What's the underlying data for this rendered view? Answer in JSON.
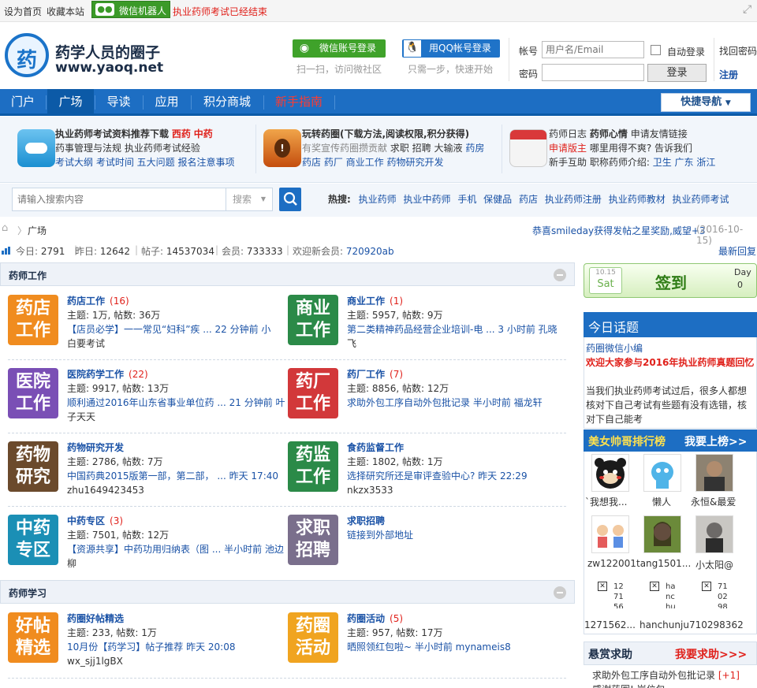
{
  "topbar": {
    "set_home": "设为首页",
    "bookmark": "收藏本站",
    "wechat_bot": "微信机器人",
    "notice": "执业药师考试已经结束"
  },
  "header": {
    "logo_char": "药",
    "site_title": "药学人员的圈子",
    "site_url": "www.yaoq.net",
    "wechat_login": "微信账号登录",
    "wechat_sub": "扫一扫，访问微社区",
    "qq_login": "用QQ帐号登录",
    "qq_sub": "只需一步，快速开始",
    "account_label": "帐号",
    "account_placeholder": "用户名/Email",
    "auto_login": "自动登录",
    "find_pwd": "找回密码",
    "password_label": "密码",
    "login_button": "登录",
    "register": "注册"
  },
  "nav": {
    "items": [
      "门户",
      "广场",
      "导读",
      "应用",
      "积分商城",
      "新手指南"
    ],
    "quick": "快捷导航"
  },
  "promo": {
    "col1": {
      "title": "执业药师考试资料推荐下载",
      "t1": "西药",
      "t2": "中药",
      "l2": "药事管理与法规  执业药师考试经验",
      "l3": "考试大纲  考试时间  五大问题  报名注意事项"
    },
    "col2": {
      "title": "玩转药圈(下载方法,阅读权限,积分获得)",
      "l2a": "有奖宣传药圈攒贡献",
      "l2b": "求职  招聘  大输液",
      "l2c": "药房",
      "l3": "药店  药厂  商业工作  药物研究开发"
    },
    "col3": {
      "l1a": "药师日志",
      "l1b": "药师心情",
      "l1c": "申请友情链接",
      "l2a": "申请版主",
      "l2b": "哪里用得不爽? 告诉我们",
      "l3a": "新手互助  职称药师介绍:",
      "l3b": "卫生  广东  浙江"
    }
  },
  "search": {
    "placeholder": "请输入搜索内容",
    "select": "搜索",
    "hot_label": "热搜:",
    "hot": [
      "执业药师",
      "执业中药师",
      "手机",
      "保健品",
      "药店",
      "执业药师注册",
      "执业药师教材",
      "执业药师考试"
    ]
  },
  "breadcrumb": {
    "current": "广场",
    "congrats": "恭喜smileday获得发帖之星奖励,威望+3",
    "congrats_date": "(2016-10-15)"
  },
  "stats": {
    "today_label": "今日:",
    "today": "2791",
    "yesterday_label": "昨日:",
    "yesterday": "12642",
    "posts_label": "帖子:",
    "posts": "14537034",
    "members_label": "会员:",
    "members": "733333",
    "welcome_label": "欢迎新会员:",
    "newest": "720920ab",
    "latest_reply": "最新回复"
  },
  "sections": [
    {
      "title": "药师工作"
    },
    {
      "title": "药师学习"
    }
  ],
  "forums": [
    {
      "tile1": "药店",
      "tile2": "工作",
      "name": "药店工作",
      "count": "(16)",
      "meta": "主题: 1万, 帖数: 36万",
      "last": "【店员必学】一一常见“妇科”疾 ... 22 分钟前  小",
      "last2": "白要考试"
    },
    {
      "tile1": "商业",
      "tile2": "工作",
      "name": "商业工作",
      "count": "(1)",
      "meta": "主题: 5957, 帖数: 9万",
      "last": "第二类精神药品经营企业培训-电 ... 3 小时前  孔晓",
      "last2": "飞"
    },
    {
      "tile1": "医院",
      "tile2": "工作",
      "name": "医院药学工作",
      "count": "(22)",
      "meta": "主题: 9917, 帖数: 13万",
      "last": "顺利通过2016年山东省事业单位药 ... 21 分钟前  叶",
      "last2": "子天天"
    },
    {
      "tile1": "药厂",
      "tile2": "工作",
      "name": "药厂工作",
      "count": "(7)",
      "meta": "主题: 8856, 帖数: 12万",
      "last": "求助外包工序自动外包批记录  半小时前  福龙轩",
      "last2": ""
    },
    {
      "tile1": "药物",
      "tile2": "研究",
      "name": "药物研究开发",
      "count": "",
      "meta": "主题: 2786, 帖数: 7万",
      "last": "中国药典2015版第一部，第二部，  ... 昨天 17:40",
      "last2": "zhu1649423453"
    },
    {
      "tile1": "药监",
      "tile2": "工作",
      "name": "食药监督工作",
      "count": "",
      "meta": "主题: 1802, 帖数: 1万",
      "last": "选择研究所还是审评查验中心?  昨天 22:29",
      "last2": "nkzx3533"
    },
    {
      "tile1": "中药",
      "tile2": "专区",
      "name": "中药专区",
      "count": "(3)",
      "meta": "主题: 7501, 帖数: 12万",
      "last": "【资源共享】中药功用归纳表（图 ... 半小时前  池边",
      "last2": "柳"
    },
    {
      "tile1": "求职",
      "tile2": "招聘",
      "name": "求职招聘",
      "count": "",
      "meta": "链接到外部地址",
      "last": "",
      "last2": ""
    },
    {
      "tile1": "好帖",
      "tile2": "精选",
      "name": "药圈好帖精选",
      "count": "",
      "meta": "主题: 233, 帖数: 1万",
      "last": "10月份【药学习】帖子推荐  昨天 20:08",
      "last2": "wx_sjj1lgBX"
    },
    {
      "tile1": "药圈",
      "tile2": "活动",
      "name": "药圈活动",
      "count": "(5)",
      "meta": "主题: 957, 帖数: 17万",
      "last": "晒照领红包啦~  半小时前  mynameis8",
      "last2": ""
    }
  ],
  "sidebar": {
    "checkin_date": "10.15",
    "checkin_day": "Sat",
    "checkin_label": "签到",
    "checkin_day_label": "Day",
    "checkin_count": "0",
    "topic_title": "今日话题",
    "topic_author": "药圈微信小编",
    "topic_headline": "欢迎大家参与2016年执业药师真题回忆",
    "topic_body": "当我们执业药师考试过后，很多人都想核对下自己考试有些题有没有选错，核对下自己能考",
    "rank_title": "美女帅哥排行榜",
    "rank_action": "我要上榜>>",
    "rank_names": [
      "`我想我...",
      "懒人",
      "永恒&最爱",
      "zw122001",
      "tang1501...",
      "小太阳@"
    ],
    "broken": [
      "12 71 56",
      "ha nc hu",
      "71 02 98"
    ],
    "broken_names": [
      "1271562...",
      "hanchunju",
      "710298362"
    ],
    "reward_title": "悬赏求助",
    "reward_action": "我要求助>>>",
    "reward_item": "求助外包工序自动外包批记录",
    "reward_pts": "[+1]",
    "reward_item2": "感谢药圈! 岗位包..."
  }
}
